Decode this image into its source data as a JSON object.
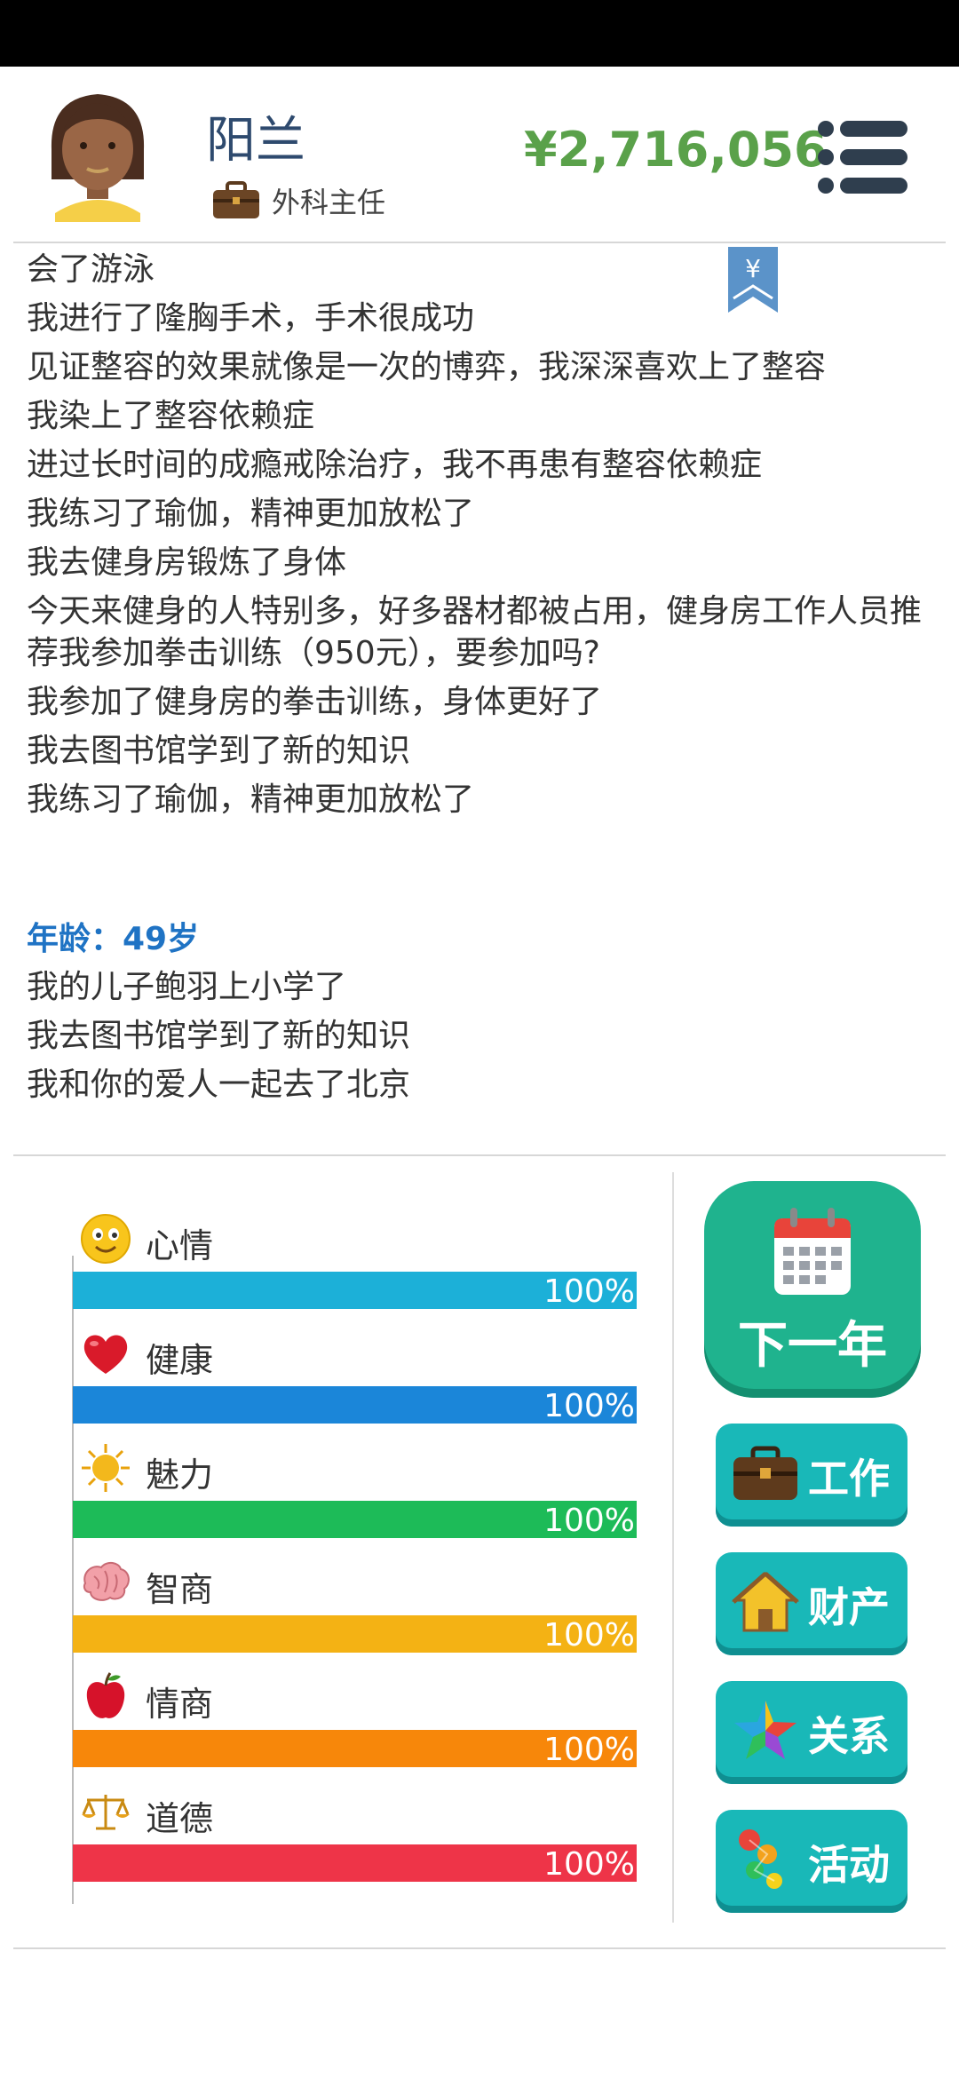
{
  "profile": {
    "name": "阳兰",
    "job": "外科主任",
    "money": "¥2,716,056"
  },
  "log_lines": [
    "会了游泳",
    "我进行了隆胸手术，手术很成功",
    "见证整容的效果就像是一次的博弈，我深深喜欢上了整容",
    "我染上了整容依赖症",
    "进过长时间的成瘾戒除治疗，我不再患有整容依赖症",
    "我练习了瑜伽，精神更加放松了",
    "我去健身房锻炼了身体",
    "今天来健身的人特别多，好多器材都被占用，健身房工作人员推荐我参加拳击训练（950元），要参加吗?",
    "我参加了健身房的拳击训练，身体更好了",
    "我去图书馆学到了新的知识",
    "我练习了瑜伽，精神更加放松了"
  ],
  "age_header": "年龄：49岁",
  "log_lines_2": [
    "我的儿子鲍羽上小学了",
    "我去图书馆学到了新的知识",
    "我和你的爱人一起去了北京"
  ],
  "bookmark_symbol": "¥",
  "stats": [
    {
      "label": "心情",
      "value": "100%",
      "level": 1.0,
      "color": "#1cb0d8",
      "icon": "smiley-icon"
    },
    {
      "label": "健康",
      "value": "100%",
      "level": 1.0,
      "color": "#1b86d9",
      "icon": "heart-icon"
    },
    {
      "label": "魅力",
      "value": "100%",
      "level": 1.0,
      "color": "#1dbb58",
      "icon": "sun-icon"
    },
    {
      "label": "智商",
      "value": "100%",
      "level": 1.0,
      "color": "#f4b214",
      "icon": "brain-icon"
    },
    {
      "label": "情商",
      "value": "100%",
      "level": 1.0,
      "color": "#f7870a",
      "icon": "apple-icon"
    },
    {
      "label": "道德",
      "value": "100%",
      "level": 1.0,
      "color": "#ee3448",
      "icon": "scales-icon"
    }
  ],
  "buttons": {
    "next_year": "下一年",
    "work": "工作",
    "property": "财产",
    "relations": "关系",
    "activities": "活动"
  }
}
